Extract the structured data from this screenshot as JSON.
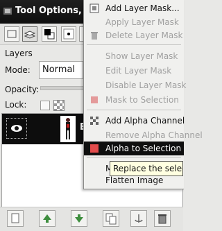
{
  "window": {
    "title": "Tool Options, Lay"
  },
  "panel": {
    "layers_label": "Layers",
    "mode_label": "Mode:",
    "mode_value": "Normal",
    "opacity_label": "Opacity:",
    "lock_label": "Lock:"
  },
  "layer": {
    "name_fragment": "E"
  },
  "menu": {
    "items": [
      {
        "label": "Add Layer Mask...",
        "enabled": true
      },
      {
        "label": "Apply Layer Mask",
        "enabled": false
      },
      {
        "label": "Delete Layer Mask",
        "enabled": false
      },
      {
        "label": "Show Layer Mask",
        "enabled": false
      },
      {
        "label": "Edit Layer Mask",
        "enabled": false
      },
      {
        "label": "Disable Layer Mask",
        "enabled": false
      },
      {
        "label": "Mask to Selection",
        "enabled": false
      },
      {
        "label": "Add Alpha Channel",
        "enabled": true
      },
      {
        "label": "Remove Alpha Channel",
        "enabled": false
      },
      {
        "label": "Alpha to Selection",
        "enabled": true,
        "highlighted": true
      },
      {
        "label": "Me",
        "enabled": true
      },
      {
        "label": "Flatten Image",
        "enabled": true
      }
    ]
  },
  "tooltip": {
    "text": "Replace the selec"
  },
  "colors": {
    "menu_highlight": "#0f0f0f",
    "tooltip_bg": "#ffffe1",
    "titlebar": "#151515"
  }
}
